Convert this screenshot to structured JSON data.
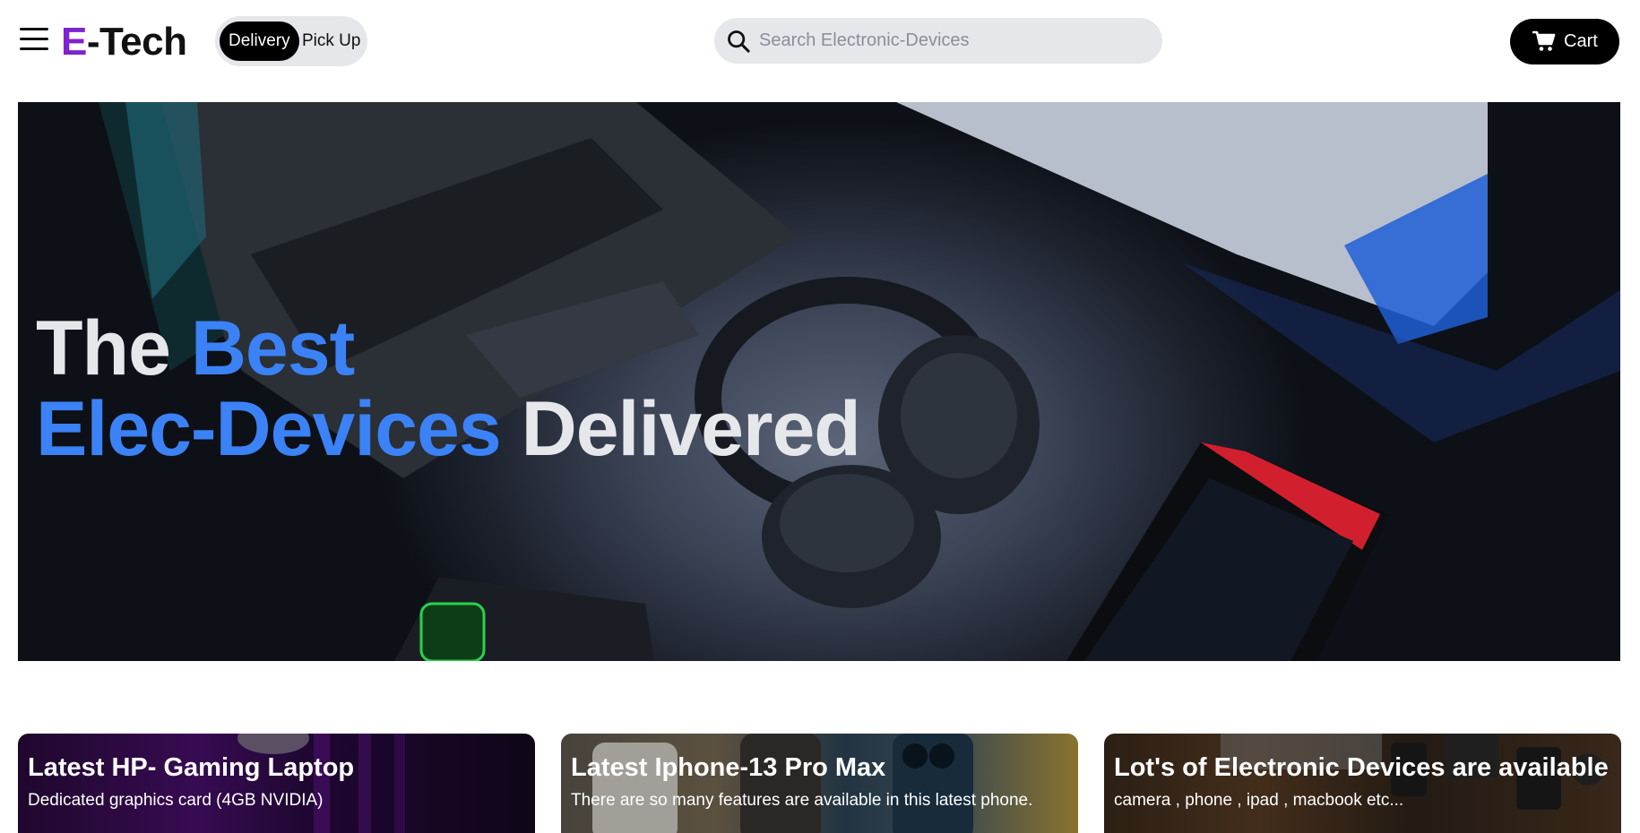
{
  "header": {
    "menu_icon": "hamburger-menu-icon",
    "logo": {
      "first": "E",
      "rest": "-Tech",
      "accent_color": "#7e22ce"
    },
    "mode_toggle": {
      "active": "Delivery",
      "inactive": "Pick Up"
    },
    "search": {
      "placeholder": "Search Electronic-Devices",
      "value": "",
      "icon": "search-icon"
    },
    "cart": {
      "label": "Cart",
      "icon": "cart-icon"
    }
  },
  "hero": {
    "line1_white": "The",
    "line1_blue": "Best",
    "line2_blue": "Elec-Devices",
    "line2_white": "Delivered",
    "accent_color": "#3b82f6"
  },
  "cards": [
    {
      "title": "Latest HP- Gaming Laptop",
      "subtitle": "Dedicated graphics card (4GB NVIDIA)"
    },
    {
      "title": "Latest Iphone-13 Pro Max",
      "subtitle": "There are so many features are available in this latest phone."
    },
    {
      "title": "Lot's of Electronic Devices are available",
      "subtitle": "camera , phone , ipad , macbook etc..."
    }
  ]
}
